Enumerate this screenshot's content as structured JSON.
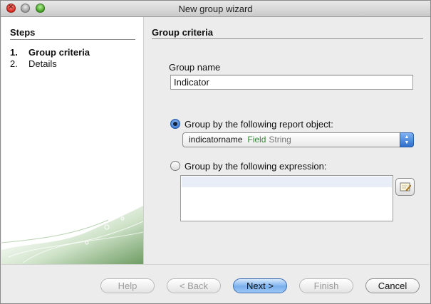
{
  "window": {
    "title": "New group wizard"
  },
  "steps": {
    "title": "Steps",
    "items": [
      {
        "num": "1.",
        "label": "Group criteria",
        "current": true
      },
      {
        "num": "2.",
        "label": "Details",
        "current": false
      }
    ]
  },
  "panel": {
    "title": "Group criteria",
    "group_name_label": "Group name",
    "group_name_value": "Indicator",
    "option_report_object": {
      "label": "Group by the following report object:",
      "selected": true,
      "select_value": {
        "name": "indicatorname",
        "kind": "Field",
        "type": "String"
      }
    },
    "option_expression": {
      "label": "Group by the following expression:",
      "selected": false,
      "value": ""
    }
  },
  "buttons": {
    "help": "Help",
    "back": "< Back",
    "next": "Next >",
    "finish": "Finish",
    "cancel": "Cancel"
  },
  "colors": {
    "accent": "#3c78d0",
    "field_kind": "#2f8a2f",
    "type_text": "#777777"
  },
  "icons": {
    "close": "close-traffic-light",
    "minimize": "minimize-traffic-light",
    "zoom": "zoom-traffic-light",
    "expression_editor": "expression-editor-icon",
    "select_stepper": "up-down-chevron-icon"
  }
}
